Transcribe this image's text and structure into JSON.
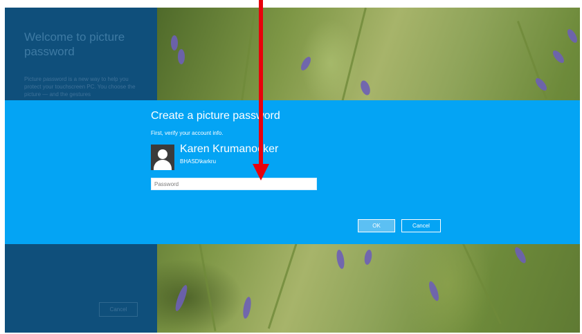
{
  "welcome": {
    "title": "Welcome to picture password",
    "body": "Picture password is a new way to help you protect your touchscreen PC. You choose the picture — and the gestures",
    "cancel_label": "Cancel"
  },
  "dialog": {
    "title": "Create a picture password",
    "subtitle": "First, verify your account info.",
    "user": {
      "name": "Karen Krumanocker",
      "account": "BHASD\\karkru"
    },
    "password": {
      "value": "",
      "placeholder": "Password"
    },
    "ok_label": "OK",
    "cancel_label": "Cancel"
  },
  "colors": {
    "dialog_band": "#04a4f4",
    "left_panel": "#0f4f7b",
    "annotation_arrow": "#e8000b"
  },
  "icons": {
    "avatar": "user-silhouette-icon",
    "annotation": "red-down-arrow"
  }
}
